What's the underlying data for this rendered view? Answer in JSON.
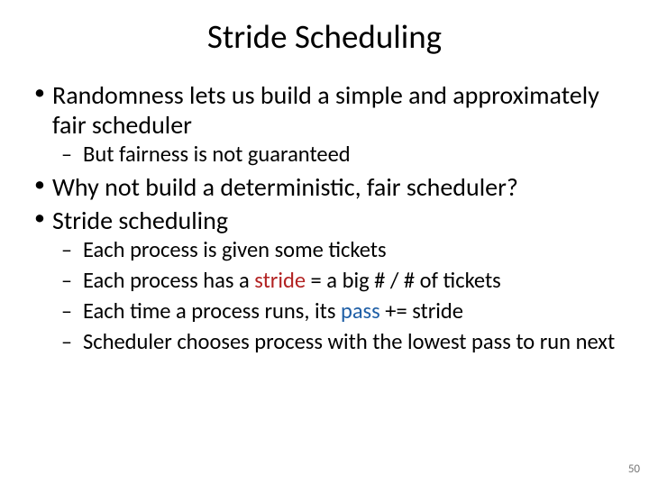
{
  "title": "Stride Scheduling",
  "bullets": {
    "b1": "Randomness lets us build a simple and approximately fair scheduler",
    "b1a": "But fairness is not guaranteed",
    "b2": "Why not build a deterministic, fair scheduler?",
    "b3": "Stride scheduling",
    "b3a": "Each process is given some tickets",
    "b3b_pre": "Each process has a ",
    "b3b_stride": "stride",
    "b3b_post": " = a big # / # of tickets",
    "b3c_pre": "Each time a process runs, its ",
    "b3c_pass": "pass",
    "b3c_post": " += stride",
    "b3d": "Scheduler chooses process with the lowest pass to run next"
  },
  "page_number": "50",
  "colors": {
    "stride": "#b22222",
    "pass": "#1f5fa6"
  }
}
